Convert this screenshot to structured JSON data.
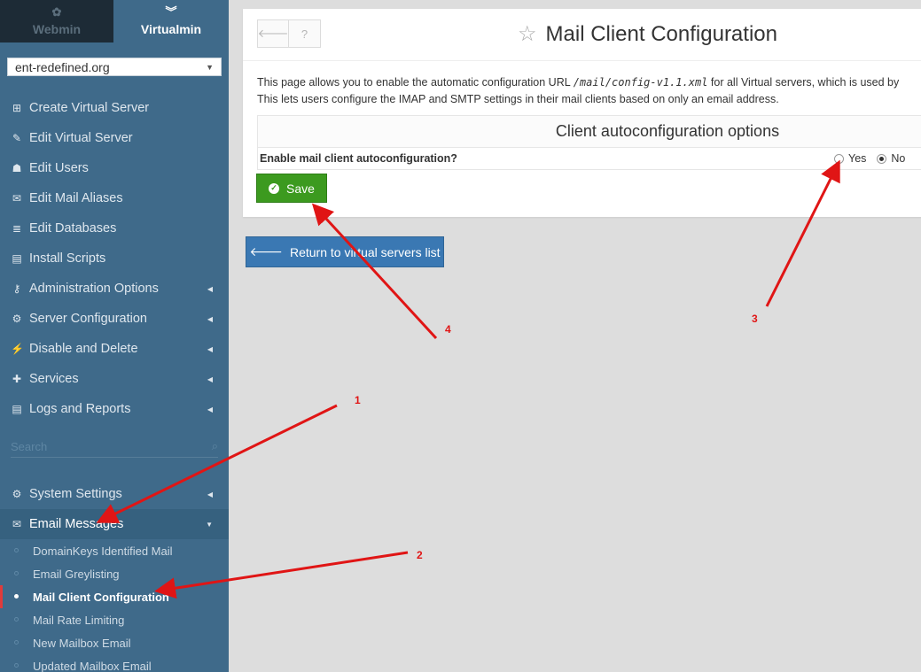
{
  "sidebar": {
    "tabs": [
      {
        "label": "Webmin",
        "icon": "webmin-logo-icon"
      },
      {
        "label": "Virtualmin",
        "icon": "chevron-down-icon"
      }
    ],
    "domain_select": "ent-redefined.org",
    "menu": [
      {
        "label": "Create Virtual Server",
        "icon": "plus-square-icon",
        "icon_glyph": "⊞"
      },
      {
        "label": "Edit Virtual Server",
        "icon": "edit-icon",
        "icon_glyph": "✎"
      },
      {
        "label": "Edit Users",
        "icon": "users-icon",
        "icon_glyph": "👥"
      },
      {
        "label": "Edit Mail Aliases",
        "icon": "envelope-outline-icon",
        "icon_glyph": "✉"
      },
      {
        "label": "Edit Databases",
        "icon": "database-icon",
        "icon_glyph": "≣"
      },
      {
        "label": "Install Scripts",
        "icon": "archive-icon",
        "icon_glyph": "▤"
      },
      {
        "label": "Administration Options",
        "icon": "key-icon",
        "icon_glyph": "⚷"
      },
      {
        "label": "Server Configuration",
        "icon": "cogs-icon",
        "icon_glyph": "⚙"
      },
      {
        "label": "Disable and Delete",
        "icon": "plug-icon",
        "icon_glyph": "⚡"
      },
      {
        "label": "Services",
        "icon": "puzzle-icon",
        "icon_glyph": "✚"
      },
      {
        "label": "Logs and Reports",
        "icon": "file-text-icon",
        "icon_glyph": "▤"
      }
    ],
    "search_placeholder": "Search",
    "system_settings": "System Settings",
    "email_messages": "Email Messages",
    "submenu": [
      "DomainKeys Identified Mail",
      "Email Greylisting",
      "Mail Client Configuration",
      "Mail Rate Limiting",
      "New Mailbox Email",
      "Updated Mailbox Email"
    ]
  },
  "main": {
    "title": "Mail Client Configuration",
    "description_line1_pre": "This page allows you to enable the automatic configuration URL",
    "description_code": "/mail/config-v1.1.xml",
    "description_line1_post": "for all Virtual servers, which is used by",
    "description_line2": "This lets users configure the IMAP and SMTP settings in their mail clients based on only an email address.",
    "section_title": "Client autoconfiguration options",
    "option_label": "Enable mail client autoconfiguration?",
    "option_yes": "Yes",
    "option_no": "No",
    "option_selected": "No",
    "save_label": "Save",
    "return_label": "Return to virtual servers list"
  },
  "annotations": {
    "numbers": [
      "1",
      "2",
      "3",
      "4"
    ],
    "color": "#e01515"
  }
}
